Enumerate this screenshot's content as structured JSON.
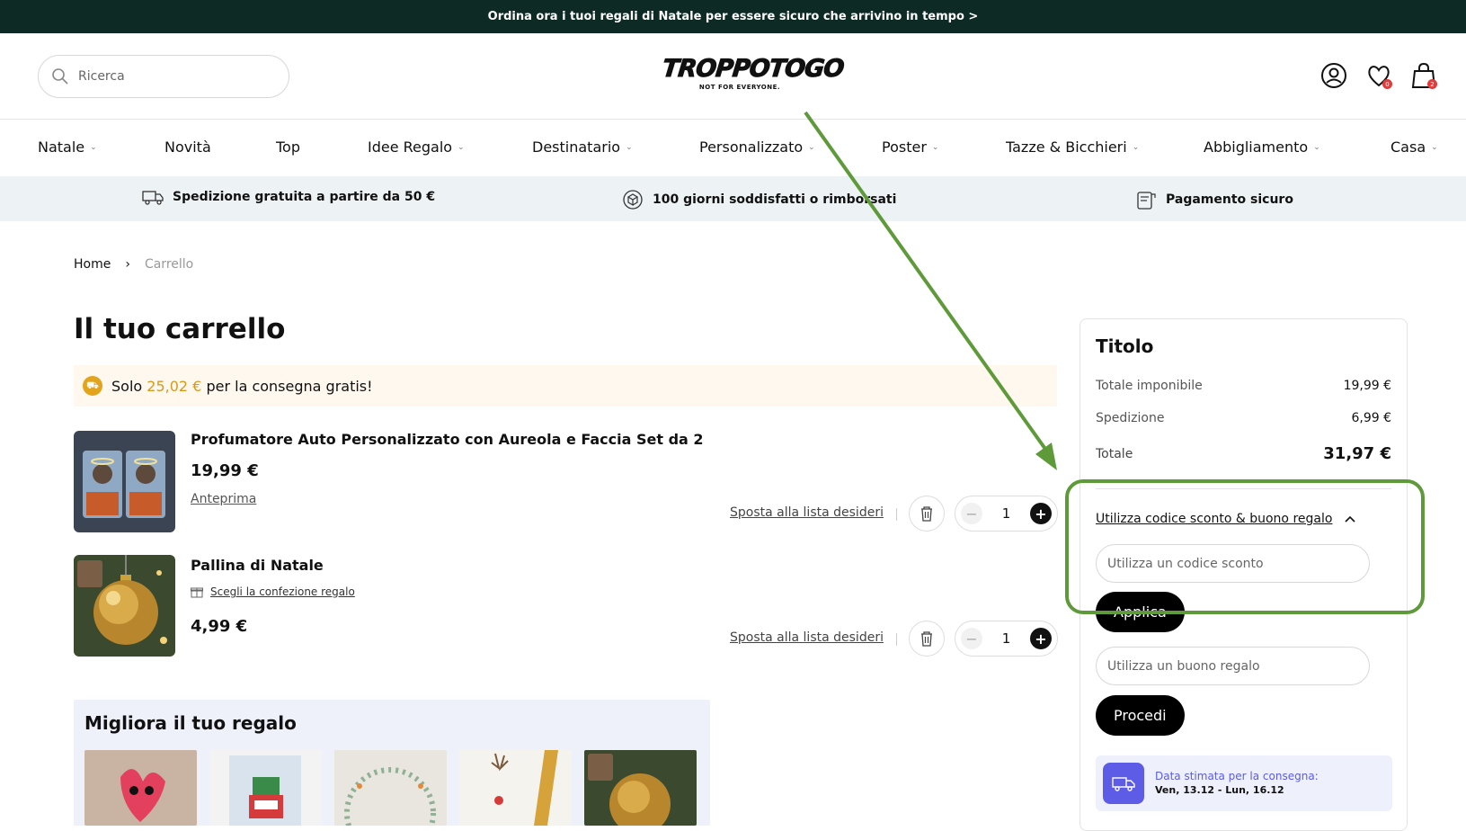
{
  "announcement": "Ordina ora i tuoi regali di Natale per essere sicuro che arrivino in tempo >",
  "search": {
    "placeholder": "Ricerca"
  },
  "logo": {
    "name": "TROPPOTOGO",
    "tagline": "NOT FOR EVERYONE."
  },
  "header_icons": {
    "wishlist_count": "0",
    "cart_count": "2"
  },
  "nav": [
    {
      "label": "Natale",
      "dropdown": true
    },
    {
      "label": "Novità",
      "dropdown": false
    },
    {
      "label": "Top",
      "dropdown": false
    },
    {
      "label": "Idee Regalo",
      "dropdown": true
    },
    {
      "label": "Destinatario",
      "dropdown": true
    },
    {
      "label": "Personalizzato",
      "dropdown": true
    },
    {
      "label": "Poster",
      "dropdown": true
    },
    {
      "label": "Tazze & Bicchieri",
      "dropdown": true
    },
    {
      "label": "Abbigliamento",
      "dropdown": true
    },
    {
      "label": "Casa",
      "dropdown": true
    }
  ],
  "benefits": [
    {
      "icon": "truck-icon",
      "label": "Spedizione gratuita a partire da 50 €"
    },
    {
      "icon": "box-return-icon",
      "label": "100 giorni soddisfatti o rimborsati"
    },
    {
      "icon": "receipt-icon",
      "label": "Pagamento sicuro"
    }
  ],
  "breadcrumb": {
    "home": "Home",
    "separator": "›",
    "current": "Carrello"
  },
  "cart": {
    "title": "Il tuo carrello",
    "free_shipping": {
      "prefix": "Solo",
      "amount": "25,02 €",
      "suffix": "per la consegna gratis!"
    },
    "items": [
      {
        "name": "Profumatore Auto Personalizzato con Aureola e Faccia Set da 2",
        "price": "19,99 €",
        "preview_link": "Anteprima",
        "wishlist_link": "Sposta alla lista desideri",
        "quantity": "1"
      },
      {
        "name": "Pallina di Natale",
        "gift_link": "Scegli la confezione regalo",
        "price": "4,99 €",
        "wishlist_link": "Sposta alla lista desideri",
        "quantity": "1"
      }
    ]
  },
  "improve": {
    "title": "Migliora il tuo regalo"
  },
  "summary": {
    "title": "Titolo",
    "subtotal_label": "Totale imponibile",
    "subtotal_value": "19,99 €",
    "shipping_label": "Spedizione",
    "shipping_value": "6,99 €",
    "total_label": "Totale",
    "total_value": "31,97 €",
    "coupon_toggle": "Utilizza codice sconto & buono regalo",
    "coupon_placeholder": "Utilizza un codice sconto",
    "apply_label": "Applica",
    "voucher_placeholder": "Utilizza un buono regalo",
    "proceed_label": "Procedi",
    "delivery_label": "Data stimata per la consegna:",
    "delivery_dates": "Ven, 13.12 - Lun, 16.12"
  },
  "colors": {
    "topbar": "#0d2b24",
    "accent_gold": "#d69a1a",
    "annotation_green": "#5e9a3a",
    "delivery_blue": "#5c5ce6"
  }
}
